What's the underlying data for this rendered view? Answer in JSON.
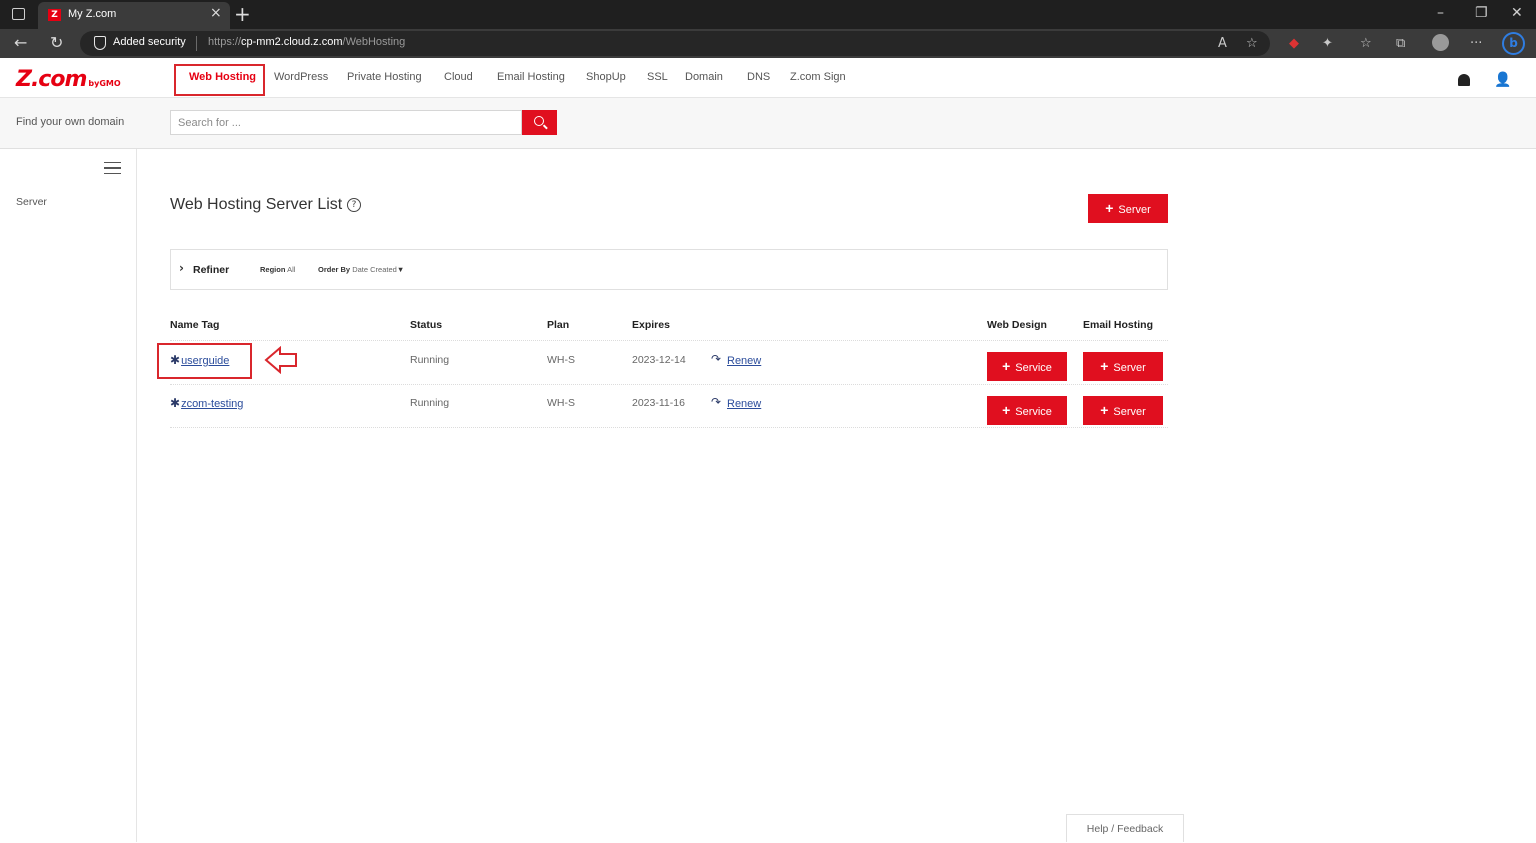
{
  "browser": {
    "tab_title": "My Z.com",
    "security_label": "Added security",
    "url_prefix": "https://",
    "url_host": "cp-mm2.cloud.z.com",
    "url_path": "/WebHosting"
  },
  "header": {
    "logo": "Z.com",
    "logo_suffix": "byGMO",
    "nav": [
      {
        "label": "Web Hosting",
        "active": true
      },
      {
        "label": "WordPress"
      },
      {
        "label": "Private Hosting"
      },
      {
        "label": "Cloud"
      },
      {
        "label": "Email Hosting"
      },
      {
        "label": "ShopUp"
      },
      {
        "label": "SSL"
      },
      {
        "label": "Domain"
      },
      {
        "label": "DNS"
      },
      {
        "label": "Z.com Sign"
      }
    ]
  },
  "domain_search": {
    "label": "Find your own domain",
    "placeholder": "Search for ..."
  },
  "sidebar": {
    "items": [
      {
        "label": "Server"
      }
    ]
  },
  "main": {
    "title": "Web Hosting Server List",
    "add_server_label": "Server",
    "refiner": {
      "label": "Refiner",
      "region_label": "Region",
      "region_value": "All",
      "order_label": "Order By",
      "order_value": "Date Created"
    },
    "columns": [
      "Name Tag",
      "Status",
      "Plan",
      "Expires",
      "Web Design",
      "Email Hosting"
    ],
    "rows": [
      {
        "name": "userguide",
        "status": "Running",
        "plan": "WH-S",
        "expires": "2023-12-14",
        "renew": "Renew",
        "web_design_btn": "Service",
        "email_btn": "Server"
      },
      {
        "name": "zcom-testing",
        "status": "Running",
        "plan": "WH-S",
        "expires": "2023-11-16",
        "renew": "Renew",
        "web_design_btn": "Service",
        "email_btn": "Server"
      }
    ]
  },
  "footer": {
    "help_feedback": "Help / Feedback"
  },
  "colors": {
    "brand_red": "#e00f1f",
    "link_blue": "#2b4c9b",
    "annotation_red": "#d9262c"
  }
}
